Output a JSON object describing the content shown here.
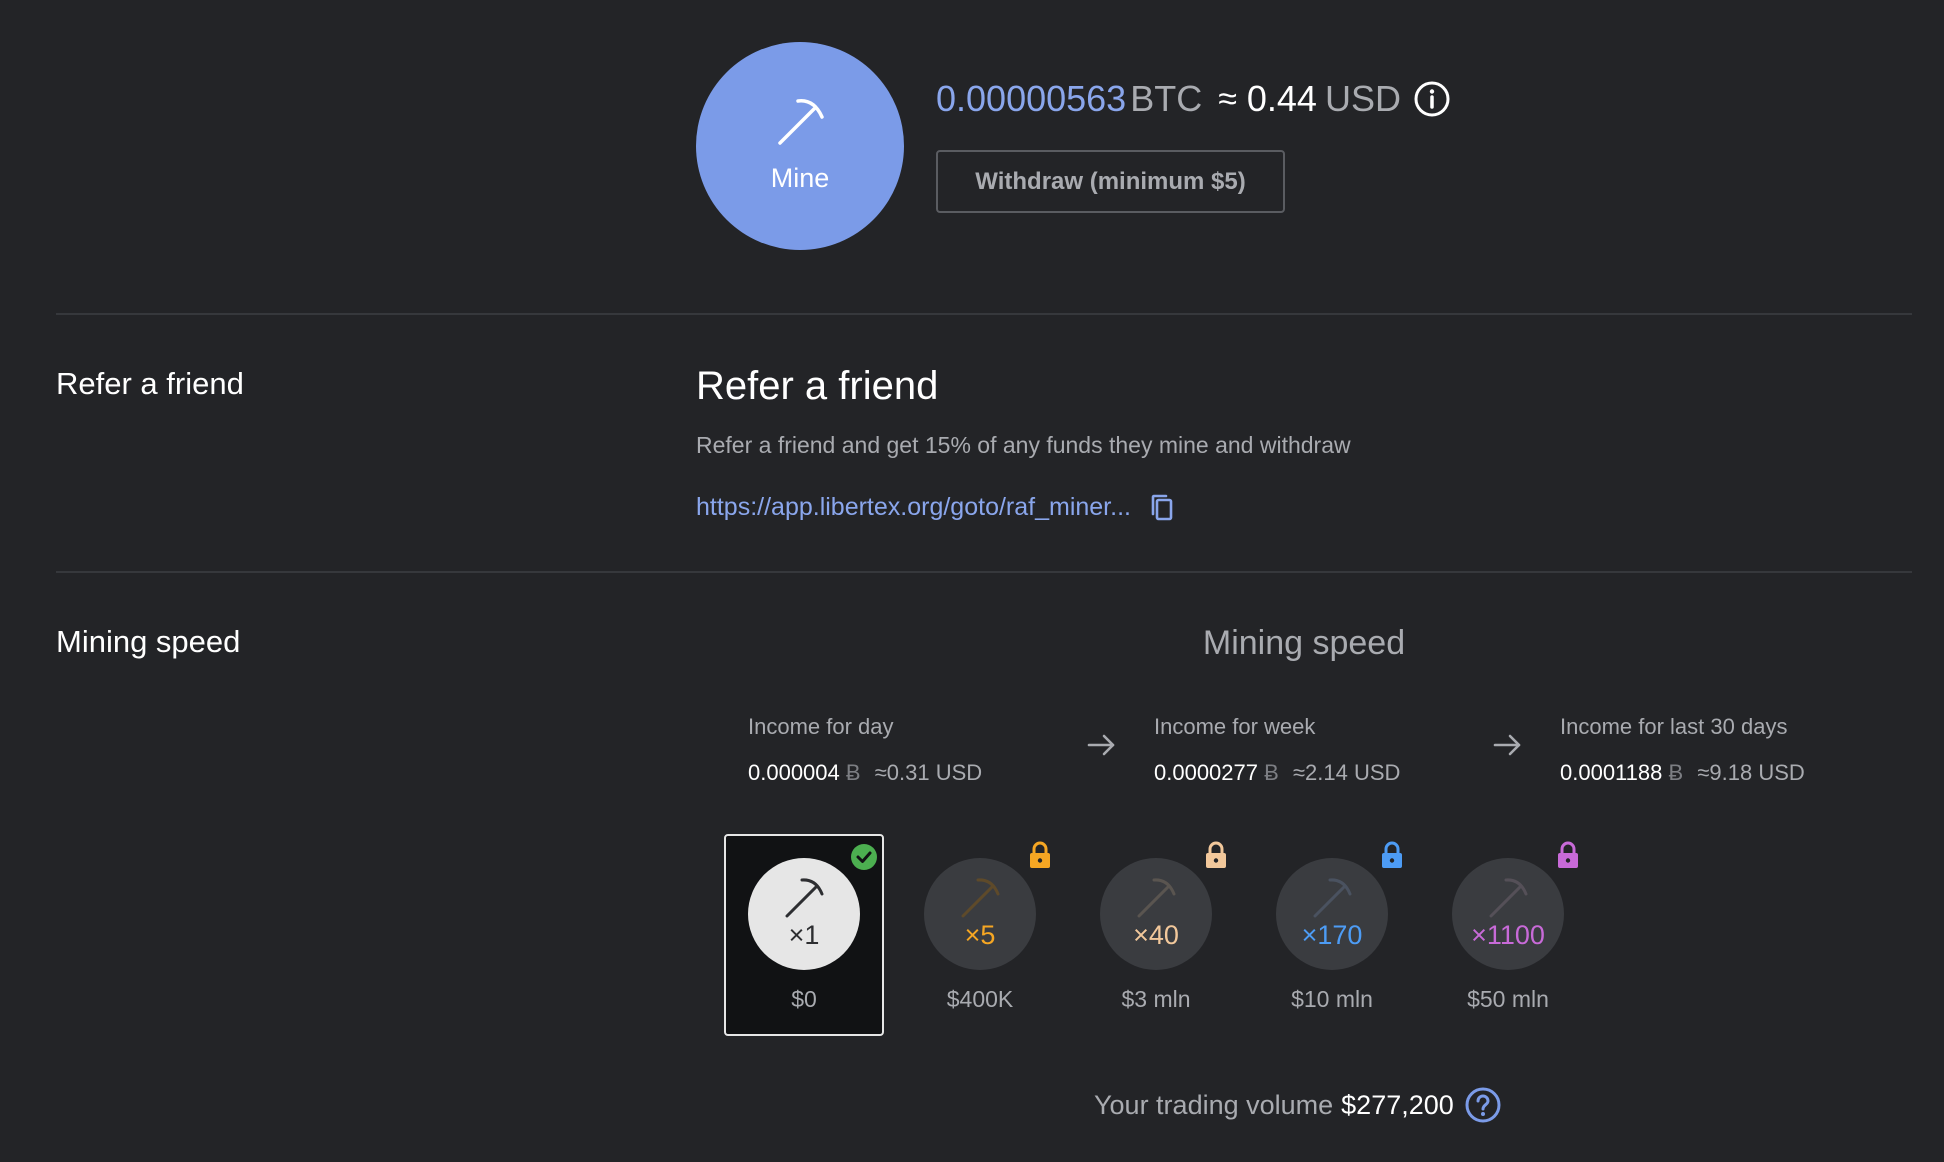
{
  "balance": {
    "mine_label": "Mine",
    "btc_amount": "0.00000563",
    "btc_unit": "BTC",
    "approx": "≈",
    "usd_amount": "0.44",
    "usd_unit": "USD",
    "withdraw_label": "Withdraw (minimum $5)"
  },
  "refer": {
    "section_label": "Refer a friend",
    "title": "Refer a friend",
    "description": "Refer a friend and get 15% of any funds they mine and withdraw",
    "link": "https://app.libertex.org/goto/raf_miner..."
  },
  "mining": {
    "section_label": "Mining speed",
    "title": "Mining speed",
    "currency_symbol": "Ƀ",
    "income": [
      {
        "label": "Income for day",
        "btc": "0.000004",
        "usd": "≈0.31 USD"
      },
      {
        "label": "Income for week",
        "btc": "0.0000277",
        "usd": "≈2.14 USD"
      },
      {
        "label": "Income for last 30 days",
        "btc": "0.0001188",
        "usd": "≈9.18 USD"
      }
    ],
    "tiers": [
      {
        "mult": "×1",
        "price": "$0",
        "color": "#2d2e31",
        "badge": "check",
        "badge_color": "#4caf50",
        "selected": true
      },
      {
        "mult": "×5",
        "price": "$400K",
        "color": "#f5a623",
        "badge": "lock",
        "badge_color": "#f5a623",
        "selected": false
      },
      {
        "mult": "×40",
        "price": "$3 mln",
        "color": "#f2c89b",
        "badge": "lock",
        "badge_color": "#f2c89b",
        "selected": false
      },
      {
        "mult": "×170",
        "price": "$10 mln",
        "color": "#4d9cf5",
        "badge": "lock",
        "badge_color": "#4d9cf5",
        "selected": false
      },
      {
        "mult": "×1100",
        "price": "$50 mln",
        "color": "#c86ad8",
        "badge": "lock",
        "badge_color": "#c86ad8",
        "selected": false
      }
    ],
    "volume_label": "Your trading volume",
    "volume_value": "$277,200"
  },
  "colors": {
    "background": "#232427",
    "accent": "#7b9be8",
    "link": "#8aa6ec",
    "muted": "#a9abb0"
  }
}
